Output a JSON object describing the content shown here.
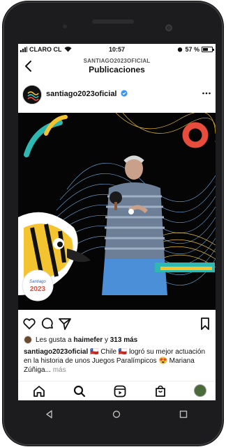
{
  "status_bar": {
    "carrier": "CLARO CL",
    "time": "10:57",
    "battery": "57 %",
    "battery_level": 0.57
  },
  "header": {
    "account": "SANTIAGO2023OFICIAL",
    "title": "Publicaciones"
  },
  "post": {
    "username": "santiago2023oficial",
    "image_text": "Santiago 2023",
    "likes": {
      "prefix": "Les gusta a",
      "user": "haimefer",
      "joiner": "y",
      "count": "313 más"
    },
    "caption": {
      "user": "santiago2023oficial",
      "text": " 🇨🇱 Chile 🇨🇱 logró su mejor actuación en la historia de unos Juegos Paralímpicos 😍 Mariana Zúñiga...",
      "more": " más"
    }
  },
  "icons": {
    "back": "chevron-left-icon",
    "more": "more-horizontal-icon",
    "like": "heart-icon",
    "comment": "comment-icon",
    "share": "send-icon",
    "save": "bookmark-icon",
    "home": "home-icon",
    "search": "search-icon",
    "reels": "reels-icon",
    "shop": "shop-icon",
    "profile": "profile-avatar"
  },
  "colors": {
    "verified": "#3897f0",
    "accent_red": "#e84c3d",
    "accent_teal": "#2fb7b1",
    "accent_yellow": "#f4c430"
  }
}
